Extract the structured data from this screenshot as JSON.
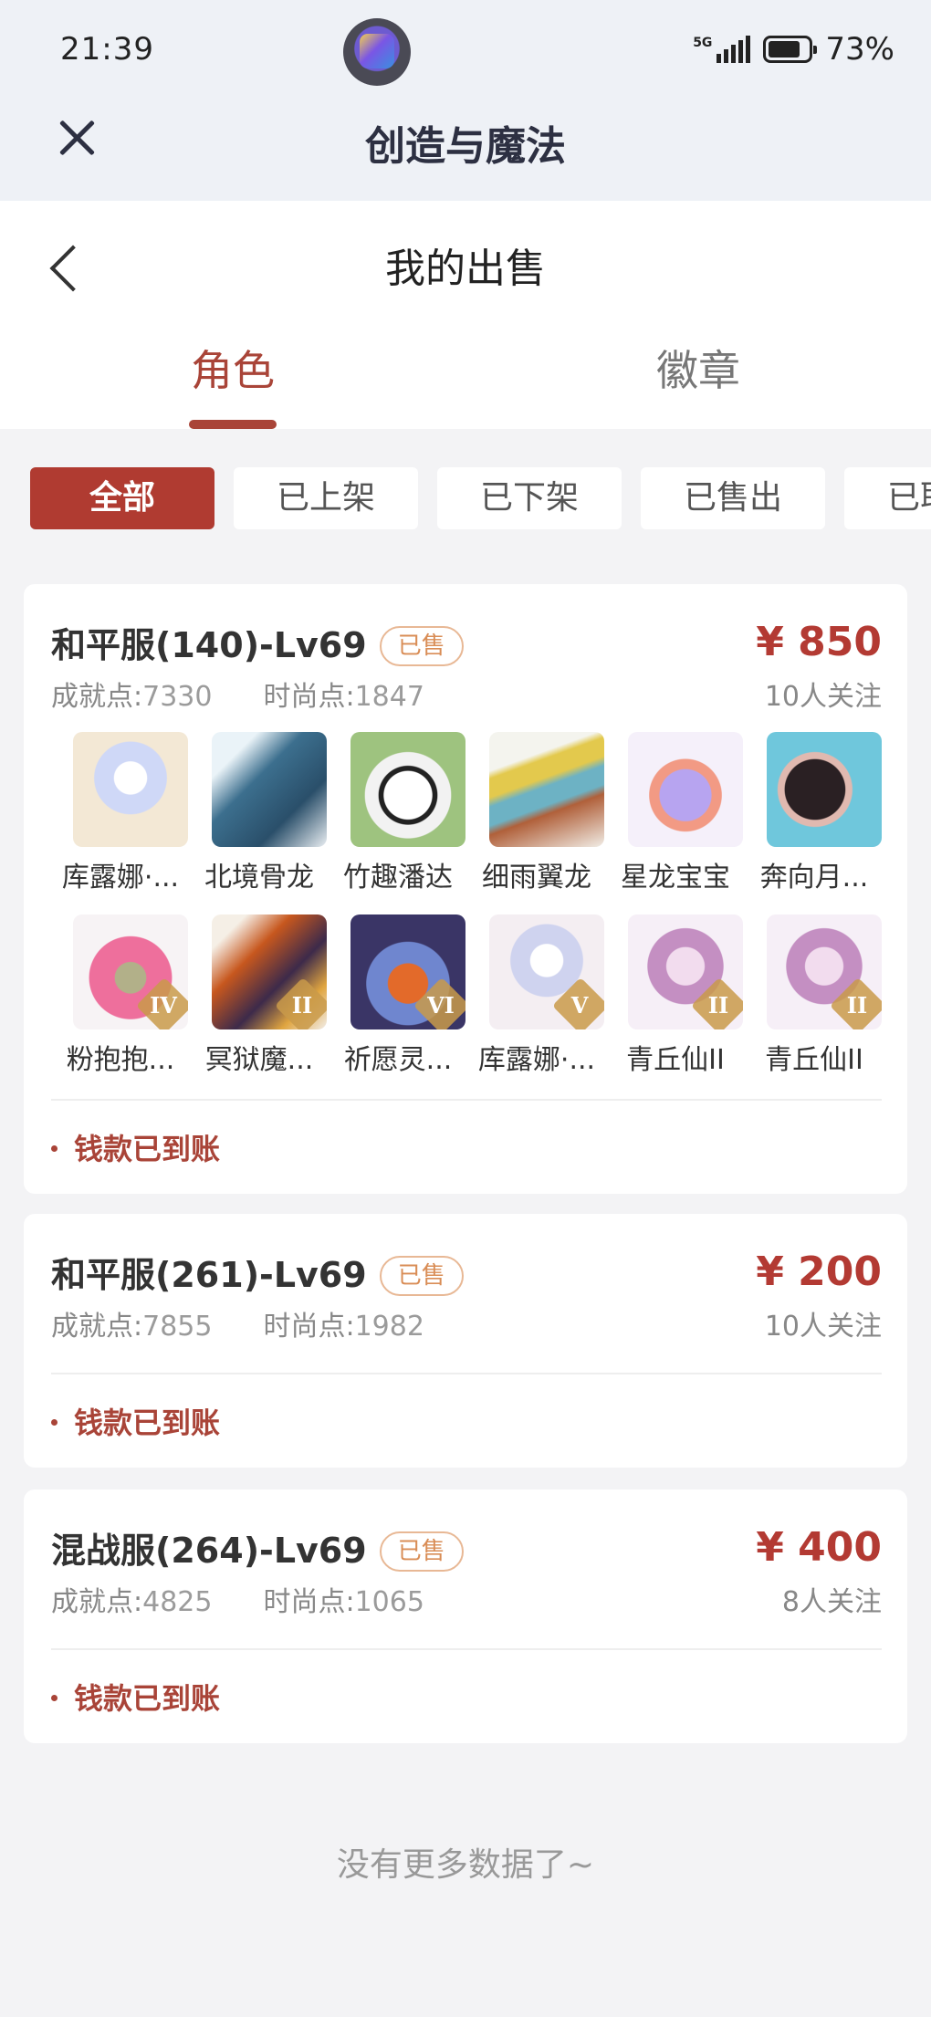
{
  "status_bar": {
    "time": "21:39",
    "network": "5G",
    "battery_percent": "73%",
    "battery_level": 0.73
  },
  "mini_program": {
    "title": "创造与魔法",
    "close_icon": "close-icon"
  },
  "page": {
    "title": "我的出售",
    "back_icon": "chevron-left-icon"
  },
  "tabs": [
    {
      "label": "角色",
      "active": true
    },
    {
      "label": "徽章",
      "active": false
    }
  ],
  "filters": [
    {
      "label": "全部",
      "active": true
    },
    {
      "label": "已上架",
      "active": false
    },
    {
      "label": "已下架",
      "active": false
    },
    {
      "label": "已售出",
      "active": false
    },
    {
      "label": "已取消",
      "active": false
    }
  ],
  "listings": [
    {
      "title": "和平服(140)-Lv69",
      "badge": "已售",
      "price": "¥ 850",
      "achievement_label": "成就点:",
      "achievement_value": "7330",
      "fashion_label": "时尚点:",
      "fashion_value": "1847",
      "followers": "10人关注",
      "status": "钱款已到账",
      "items": [
        {
          "name": "库露娜·...",
          "level": ""
        },
        {
          "name": "北境骨龙",
          "level": ""
        },
        {
          "name": "竹趣潘达",
          "level": ""
        },
        {
          "name": "细雨翼龙",
          "level": ""
        },
        {
          "name": "星龙宝宝",
          "level": ""
        },
        {
          "name": "奔向月...",
          "level": ""
        },
        {
          "name": "粉抱抱...",
          "level": "IV"
        },
        {
          "name": "冥狱魔...",
          "level": "II"
        },
        {
          "name": "祈愿灵...",
          "level": "VI"
        },
        {
          "name": "库露娜·...",
          "level": "V"
        },
        {
          "name": "青丘仙II",
          "level": "II"
        },
        {
          "name": "青丘仙II",
          "level": "II"
        }
      ]
    },
    {
      "title": "和平服(261)-Lv69",
      "badge": "已售",
      "price": "¥ 200",
      "achievement_label": "成就点:",
      "achievement_value": "7855",
      "fashion_label": "时尚点:",
      "fashion_value": "1982",
      "followers": "10人关注",
      "status": "钱款已到账"
    },
    {
      "title": "混战服(264)-Lv69",
      "badge": "已售",
      "price": "¥ 400",
      "achievement_label": "成就点:",
      "achievement_value": "4825",
      "fashion_label": "时尚点:",
      "fashion_value": "1065",
      "followers": "8人关注",
      "status": "钱款已到账"
    }
  ],
  "footer": {
    "no_more": "没有更多数据了~"
  },
  "colors": {
    "accent": "#a94438",
    "price": "#b33a33",
    "badge": "#d98d56",
    "background": "#f3f3f5"
  }
}
